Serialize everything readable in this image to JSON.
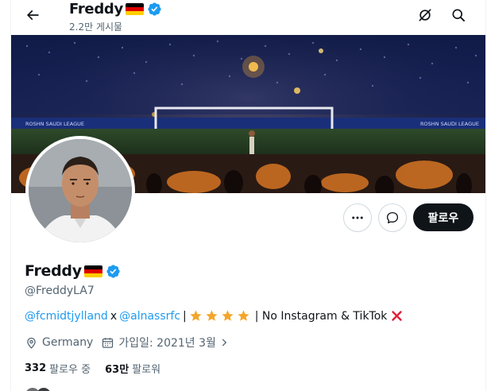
{
  "header": {
    "name": "Freddy",
    "posts_count": "2.2만 게시물"
  },
  "profile": {
    "name": "Freddy",
    "handle": "@FreddyLA7",
    "bio": {
      "link1": "@fcmidtjylland",
      "sep1": "x",
      "link2": "@alnassrfc",
      "sep2": "|",
      "sep3": "| No Instagram & TikTok",
      "stars": 4
    },
    "location": "Germany",
    "joined": "가입일: 2021년 3월"
  },
  "stats": {
    "following_count": "332",
    "following_label": "팔로우 중",
    "followers_count": "63만",
    "followers_label": "팔로워"
  },
  "actions": {
    "follow_label": "팔로우"
  },
  "banner_text": {
    "board_1": "ROSHN SAUDI LEAGUE",
    "board_2": "ROSHN SAUDI LEAGUE"
  },
  "icons": {
    "back": "arrow-left-icon",
    "grok": "grok-icon",
    "search": "search-icon",
    "more": "more-icon",
    "message": "message-icon",
    "location": "location-pin-icon",
    "calendar": "calendar-icon",
    "chevron": "chevron-right-icon",
    "verified": "verified-badge-icon",
    "flag": "germany-flag-icon",
    "star": "star-icon",
    "cross": "red-cross-icon"
  },
  "colors": {
    "accent": "#1d9bf0",
    "text_primary": "#0f1419",
    "text_secondary": "#536471",
    "follow_button": "#0f1419"
  }
}
